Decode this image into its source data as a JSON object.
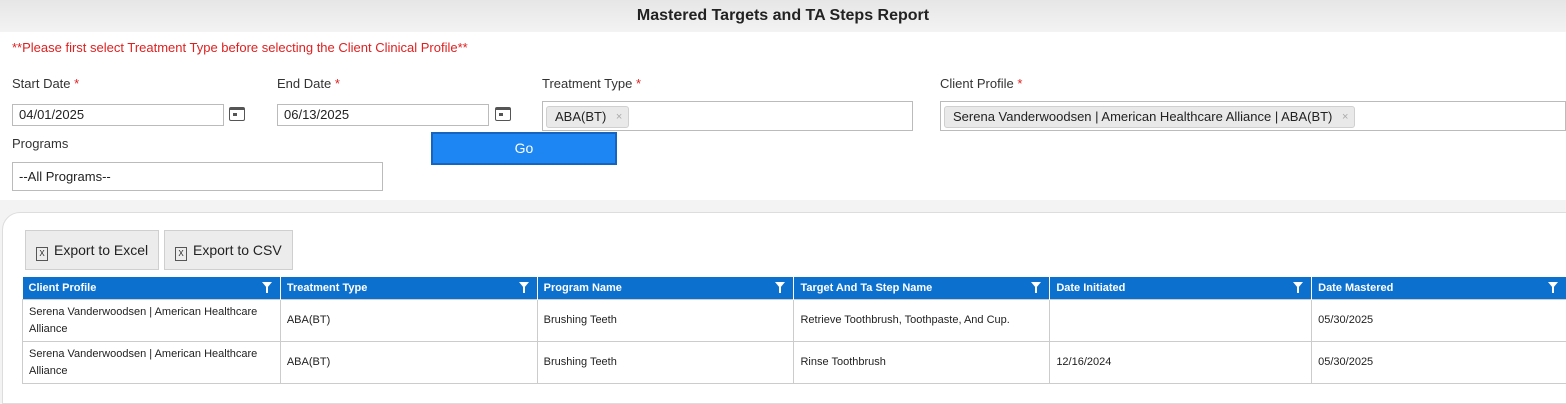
{
  "page": {
    "title": "Mastered Targets and TA Steps Report"
  },
  "filters": {
    "warning": "**Please first select Treatment Type before selecting the Client Clinical Profile**",
    "required_mark": "*",
    "start_date": {
      "label": "Start Date",
      "value": "04/01/2025"
    },
    "end_date": {
      "label": "End Date",
      "value": "06/13/2025"
    },
    "treatment_type": {
      "label": "Treatment Type",
      "chip": "ABA(BT)"
    },
    "client_profile": {
      "label": "Client Profile",
      "chip": "Serena Vanderwoodsen | American Healthcare Alliance | ABA(BT)"
    },
    "programs": {
      "label": "Programs",
      "value": "--All Programs--"
    },
    "go_label": "Go",
    "chip_remove": "×"
  },
  "toolbar": {
    "export_excel": "Export to Excel",
    "export_csv": "Export to CSV",
    "excel_icon": "X"
  },
  "table": {
    "columns": [
      "Client Profile",
      "Treatment Type",
      "Program Name",
      "Target And Ta Step Name",
      "Date Initiated",
      "Date Mastered"
    ],
    "rows": [
      [
        "Serena Vanderwoodsen | American Healthcare Alliance",
        "ABA(BT)",
        "Brushing Teeth",
        "Retrieve Toothbrush, Toothpaste, And Cup.",
        "",
        "05/30/2025"
      ],
      [
        "Serena Vanderwoodsen | American Healthcare Alliance",
        "ABA(BT)",
        "Brushing Teeth",
        "Rinse Toothbrush",
        "12/16/2024",
        "05/30/2025"
      ]
    ]
  },
  "colors": {
    "accent": "#0c70cf",
    "go_button": "#1e86f2",
    "required": "#e02020"
  }
}
